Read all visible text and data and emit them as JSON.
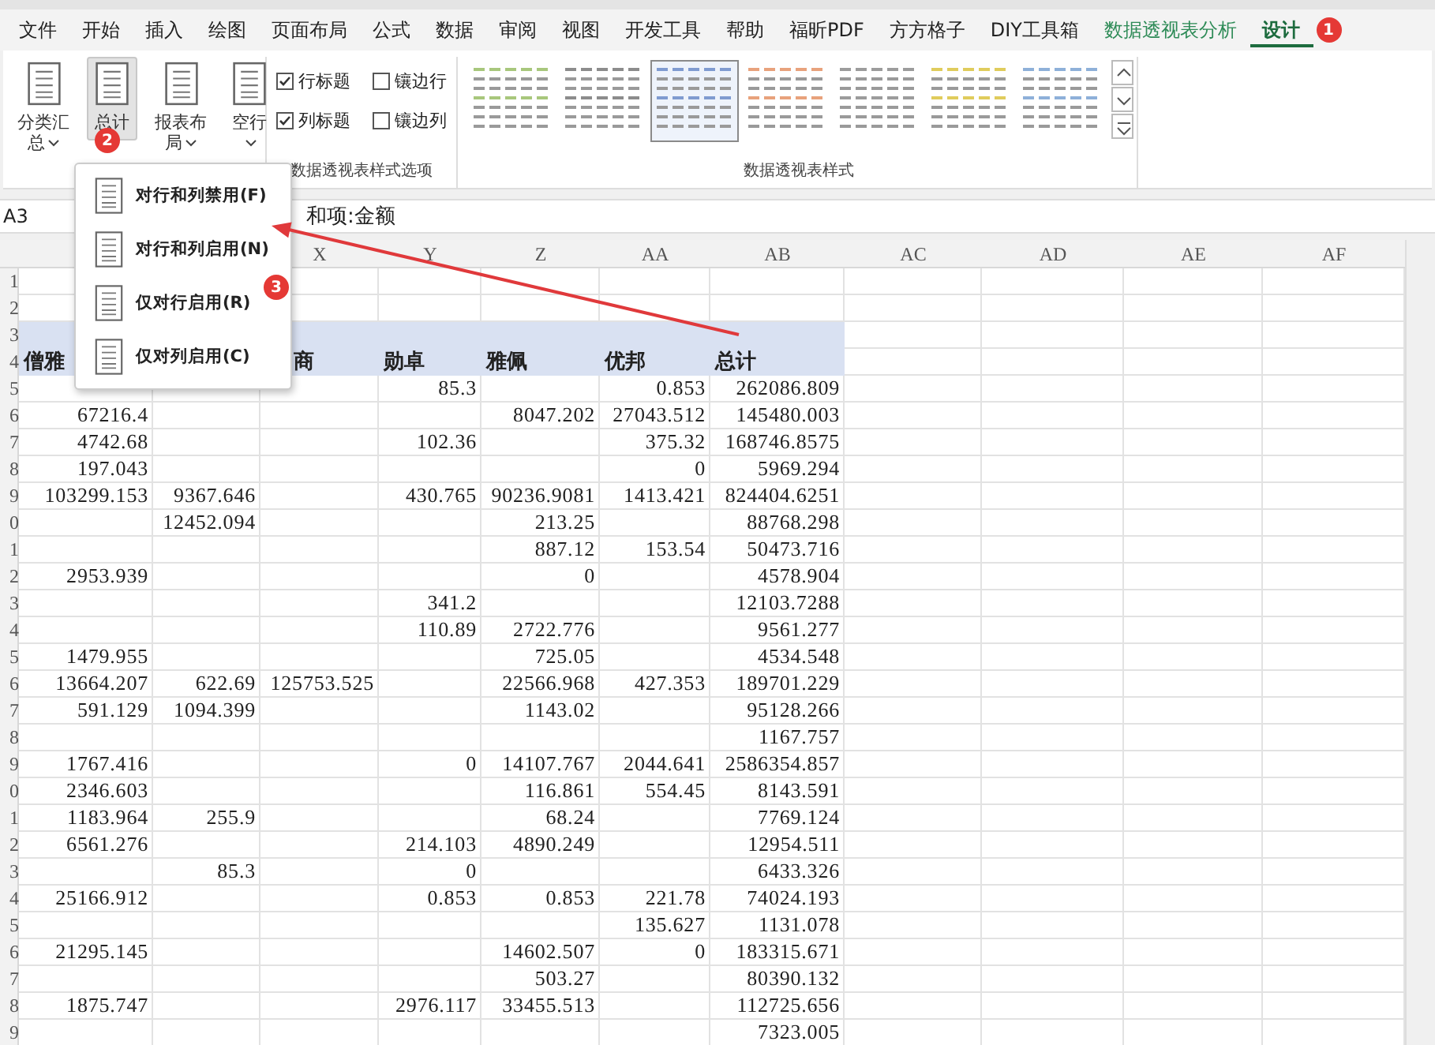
{
  "ribbon_tabs": [
    {
      "label": "文件",
      "kind": "normal",
      "selected": false
    },
    {
      "label": "开始",
      "kind": "normal",
      "selected": false
    },
    {
      "label": "插入",
      "kind": "normal",
      "selected": false
    },
    {
      "label": "绘图",
      "kind": "normal",
      "selected": false
    },
    {
      "label": "页面布局",
      "kind": "normal",
      "selected": false
    },
    {
      "label": "公式",
      "kind": "normal",
      "selected": false
    },
    {
      "label": "数据",
      "kind": "normal",
      "selected": false
    },
    {
      "label": "审阅",
      "kind": "normal",
      "selected": false
    },
    {
      "label": "视图",
      "kind": "normal",
      "selected": false
    },
    {
      "label": "开发工具",
      "kind": "normal",
      "selected": false
    },
    {
      "label": "帮助",
      "kind": "normal",
      "selected": false
    },
    {
      "label": "福昕PDF",
      "kind": "normal",
      "selected": false
    },
    {
      "label": "方方格子",
      "kind": "normal",
      "selected": false
    },
    {
      "label": "DIY工具箱",
      "kind": "normal",
      "selected": false
    },
    {
      "label": "数据透视表分析",
      "kind": "contextual",
      "selected": false
    },
    {
      "label": "设计",
      "kind": "contextual",
      "selected": true,
      "badge": "1"
    }
  ],
  "ribbon": {
    "buttons": [
      {
        "label": "分类汇总",
        "dropdown": true,
        "pressed": false
      },
      {
        "label": "总计",
        "dropdown": false,
        "pressed": true,
        "badge": "2"
      },
      {
        "label": "报表布局",
        "dropdown": true,
        "pressed": false
      },
      {
        "label": "空行",
        "dropdown": true,
        "pressed": false
      }
    ],
    "options": {
      "label": "数据透视表样式选项",
      "items": [
        {
          "label": "行标题",
          "checked": true
        },
        {
          "label": "镶边行",
          "checked": false
        },
        {
          "label": "列标题",
          "checked": true
        },
        {
          "label": "镶边列",
          "checked": false
        }
      ]
    },
    "styles": {
      "label": "数据透视表样式",
      "items": [
        {
          "color": "#a8c77c",
          "selected": false
        },
        {
          "color": "#8c8c8c",
          "selected": false
        },
        {
          "color": "#7f9bd0",
          "selected": true
        },
        {
          "color": "#e8a27c",
          "selected": false
        },
        {
          "color": "#9c9c9c",
          "selected": false
        },
        {
          "color": "#e0cc5c",
          "selected": false
        },
        {
          "color": "#8eb0d9",
          "selected": false
        }
      ]
    }
  },
  "formula_bar": {
    "name_box": "A3",
    "formula": "和项:金额"
  },
  "dropdown_menu": {
    "badge": "3",
    "items": [
      {
        "label": "对行和列禁用(F)"
      },
      {
        "label": "对行和列启用(N)"
      },
      {
        "label": "仅对行启用(R)"
      },
      {
        "label": "仅对列启用(C)"
      }
    ]
  },
  "sheet": {
    "columns": [
      "X",
      "Y",
      "Z",
      "AA",
      "AB",
      "AC",
      "AD",
      "AE",
      "AF"
    ],
    "rows": [
      {
        "number": "1",
        "kind": "blank"
      },
      {
        "number": "2",
        "kind": "blank"
      },
      {
        "number": "3",
        "kind": "band"
      },
      {
        "number": "4",
        "kind": "header",
        "cells": [
          "僧雅",
          null,
          "商",
          "勋卓",
          "雅佩",
          "优邦",
          "总计"
        ]
      },
      {
        "number": "5",
        "kind": "data",
        "cells": [
          null,
          null,
          null,
          "85.3",
          null,
          "0.853",
          "262086.809"
        ]
      },
      {
        "number": "6",
        "kind": "data",
        "cells": [
          "67216.4",
          null,
          null,
          null,
          "8047.202",
          "27043.512",
          "145480.003"
        ]
      },
      {
        "number": "7",
        "kind": "data",
        "cells": [
          "4742.68",
          null,
          null,
          "102.36",
          null,
          "375.32",
          "168746.8575"
        ]
      },
      {
        "number": "8",
        "kind": "data",
        "cells": [
          "197.043",
          null,
          null,
          null,
          null,
          "0",
          "5969.294"
        ]
      },
      {
        "number": "9",
        "kind": "data",
        "cells": [
          "103299.153",
          "9367.646",
          null,
          "430.765",
          "90236.9081",
          "1413.421",
          "824404.6251"
        ]
      },
      {
        "number": "0",
        "kind": "data",
        "cells": [
          null,
          "12452.094",
          null,
          null,
          "213.25",
          null,
          "88768.298"
        ]
      },
      {
        "number": "1",
        "kind": "data",
        "cells": [
          null,
          null,
          null,
          null,
          "887.12",
          "153.54",
          "50473.716"
        ]
      },
      {
        "number": "2",
        "kind": "data",
        "cells": [
          "2953.939",
          null,
          null,
          null,
          "0",
          null,
          "4578.904"
        ]
      },
      {
        "number": "3",
        "kind": "data",
        "cells": [
          null,
          null,
          null,
          "341.2",
          null,
          null,
          "12103.7288"
        ]
      },
      {
        "number": "4",
        "kind": "data",
        "cells": [
          null,
          null,
          null,
          "110.89",
          "2722.776",
          null,
          "9561.277"
        ]
      },
      {
        "number": "5",
        "kind": "data",
        "cells": [
          "1479.955",
          null,
          null,
          null,
          "725.05",
          null,
          "4534.548"
        ]
      },
      {
        "number": "6",
        "kind": "data",
        "cells": [
          "13664.207",
          "622.69",
          "125753.525",
          null,
          "22566.968",
          "427.353",
          "189701.229"
        ]
      },
      {
        "number": "7",
        "kind": "data",
        "cells": [
          "591.129",
          "1094.399",
          null,
          null,
          "1143.02",
          null,
          "95128.266"
        ]
      },
      {
        "number": "8",
        "kind": "data",
        "cells": [
          null,
          null,
          null,
          null,
          null,
          null,
          "1167.757"
        ]
      },
      {
        "number": "9",
        "kind": "data",
        "cells": [
          "1767.416",
          null,
          null,
          "0",
          "14107.767",
          "2044.641",
          "2586354.857"
        ]
      },
      {
        "number": "0",
        "kind": "data",
        "cells": [
          "2346.603",
          null,
          null,
          null,
          "116.861",
          "554.45",
          "8143.591"
        ]
      },
      {
        "number": "1",
        "kind": "data",
        "cells": [
          "1183.964",
          "255.9",
          null,
          null,
          "68.24",
          null,
          "7769.124"
        ]
      },
      {
        "number": "2",
        "kind": "data",
        "cells": [
          "6561.276",
          null,
          null,
          "214.103",
          "4890.249",
          null,
          "12954.511"
        ]
      },
      {
        "number": "3",
        "kind": "data",
        "cells": [
          null,
          "85.3",
          null,
          "0",
          null,
          null,
          "6433.326"
        ]
      },
      {
        "number": "4",
        "kind": "data",
        "cells": [
          "25166.912",
          null,
          null,
          "0.853",
          "0.853",
          "221.78",
          "74024.193"
        ]
      },
      {
        "number": "5",
        "kind": "data",
        "cells": [
          null,
          null,
          null,
          null,
          null,
          "135.627",
          "1131.078"
        ]
      },
      {
        "number": "6",
        "kind": "data",
        "cells": [
          "21295.145",
          null,
          null,
          null,
          "14602.507",
          "0",
          "183315.671"
        ]
      },
      {
        "number": "7",
        "kind": "data",
        "cells": [
          null,
          null,
          null,
          null,
          "503.27",
          null,
          "80390.132"
        ]
      },
      {
        "number": "8",
        "kind": "data",
        "cells": [
          "1875.747",
          null,
          null,
          "2976.117",
          "33455.513",
          null,
          "112725.656"
        ]
      },
      {
        "number": "9",
        "kind": "data",
        "cells": [
          null,
          null,
          null,
          null,
          null,
          null,
          "7323.005"
        ]
      }
    ]
  }
}
